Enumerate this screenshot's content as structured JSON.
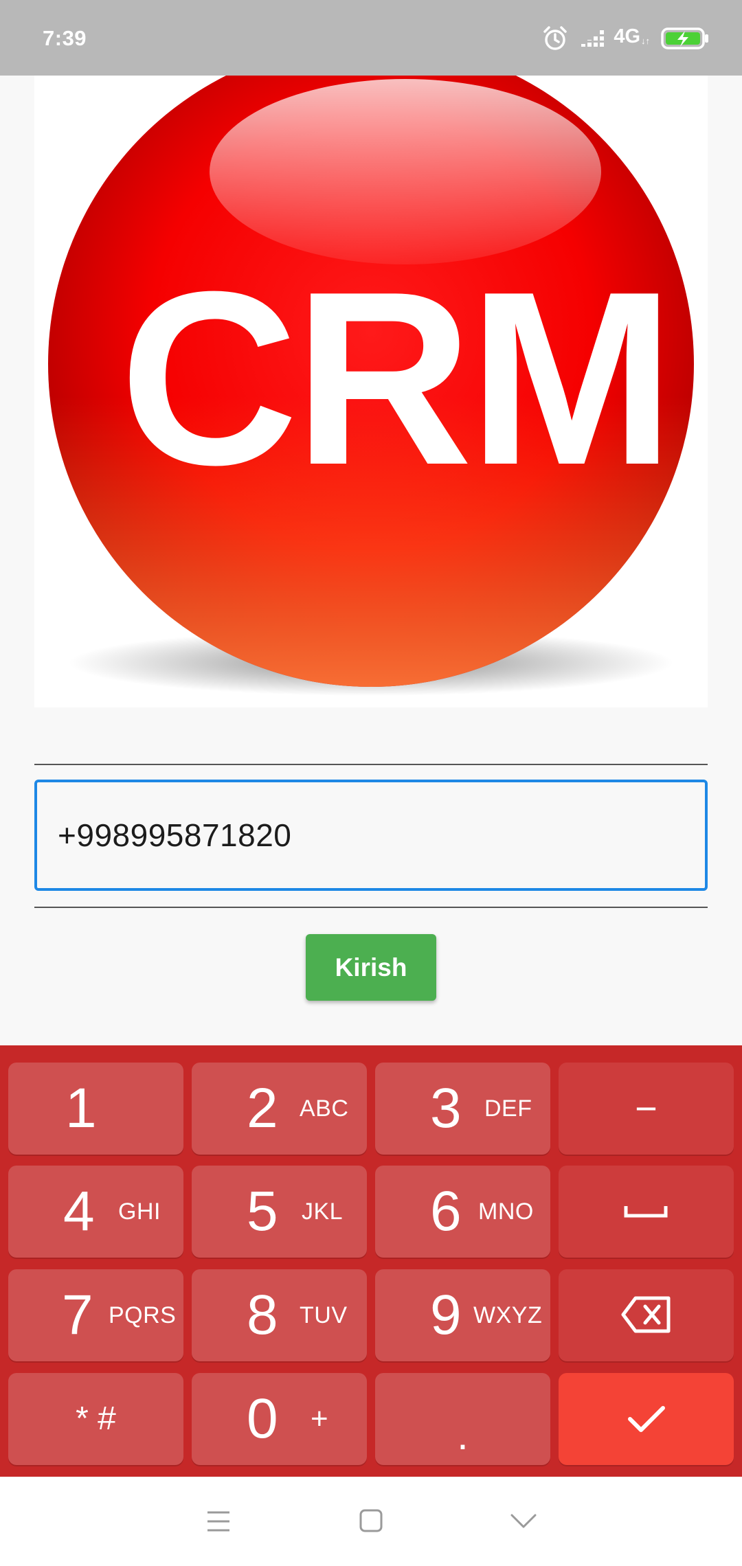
{
  "status_bar": {
    "time": "7:39",
    "network": "4G",
    "icons": [
      "alarm-icon",
      "signal-icon",
      "network-4g-icon",
      "battery-charging-icon"
    ]
  },
  "logo": {
    "text": "CRM",
    "color": "#f00000"
  },
  "phone_input": {
    "value": "+998995871820",
    "accent": "#1e88e5"
  },
  "submit_button": {
    "label": "Kirish",
    "color": "#4caf50"
  },
  "keypad": {
    "background": "#c62828",
    "keys": [
      {
        "digit": "1",
        "letters": ""
      },
      {
        "digit": "2",
        "letters": "ABC"
      },
      {
        "digit": "3",
        "letters": "DEF"
      },
      {
        "symbol": "−",
        "name": "minus"
      },
      {
        "digit": "4",
        "letters": "GHI"
      },
      {
        "digit": "5",
        "letters": "JKL"
      },
      {
        "digit": "6",
        "letters": "MNO"
      },
      {
        "icon": "space-icon"
      },
      {
        "digit": "7",
        "letters": "PQRS"
      },
      {
        "digit": "8",
        "letters": "TUV"
      },
      {
        "digit": "9",
        "letters": "WXYZ"
      },
      {
        "icon": "backspace-icon"
      },
      {
        "symbol": "* #",
        "name": "star-hash"
      },
      {
        "digit": "0",
        "letters": "+"
      },
      {
        "symbol": ".",
        "name": "period"
      },
      {
        "icon": "checkmark-icon"
      }
    ]
  },
  "nav_bar": {
    "icons": [
      "menu-icon",
      "home-icon",
      "back-icon"
    ]
  }
}
